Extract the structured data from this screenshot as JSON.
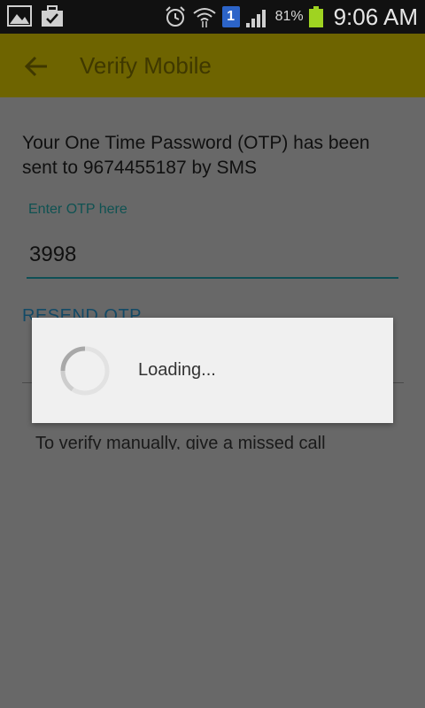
{
  "status_bar": {
    "left_icons": [
      "gallery-icon",
      "briefcase-check-icon"
    ],
    "right_icons": [
      "alarm-icon",
      "wifi-icon",
      "sim-icon",
      "signal-icon",
      "battery-icon"
    ],
    "sim_label": "1",
    "battery_percent": "81%",
    "battery_level": 81,
    "time": "9:06 AM"
  },
  "app_bar": {
    "title": "Verify Mobile",
    "color": "#6e6400",
    "back_icon": "arrow-back-icon"
  },
  "otp_form": {
    "message": "Your One Time Password (OTP) has been sent to 9674455187 by SMS",
    "input_label": "Enter OTP here",
    "input_value": "3998",
    "resend_label": "RESEND OTP",
    "manual_text": "To verify manually, give a missed call"
  },
  "loading_dialog": {
    "text": "Loading..."
  }
}
